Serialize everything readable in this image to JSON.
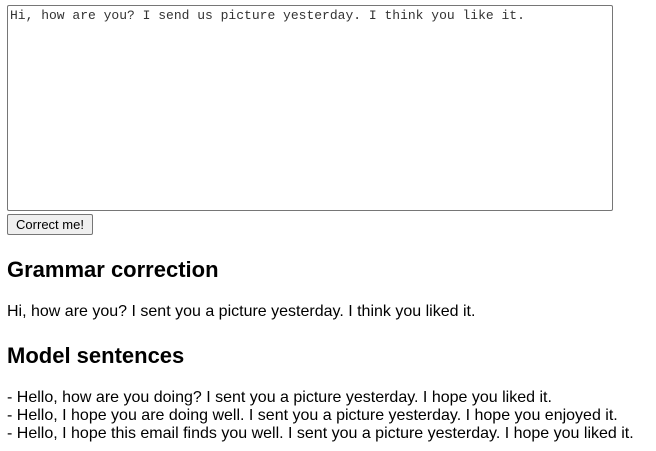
{
  "input": {
    "value": "Hi, how are you? I send us picture yesterday. I think you like it."
  },
  "button": {
    "label": "Correct me!"
  },
  "grammar": {
    "heading": "Grammar correction",
    "text": "Hi, how are you? I sent you a picture yesterday. I think you liked it."
  },
  "model": {
    "heading": "Model sentences",
    "sentences": [
      "- Hello, how are you doing? I sent you a picture yesterday. I hope you liked it.",
      "- Hello, I hope you are doing well. I sent you a picture yesterday. I hope you enjoyed it.",
      "- Hello, I hope this email finds you well. I sent you a picture yesterday. I hope you liked it."
    ]
  }
}
